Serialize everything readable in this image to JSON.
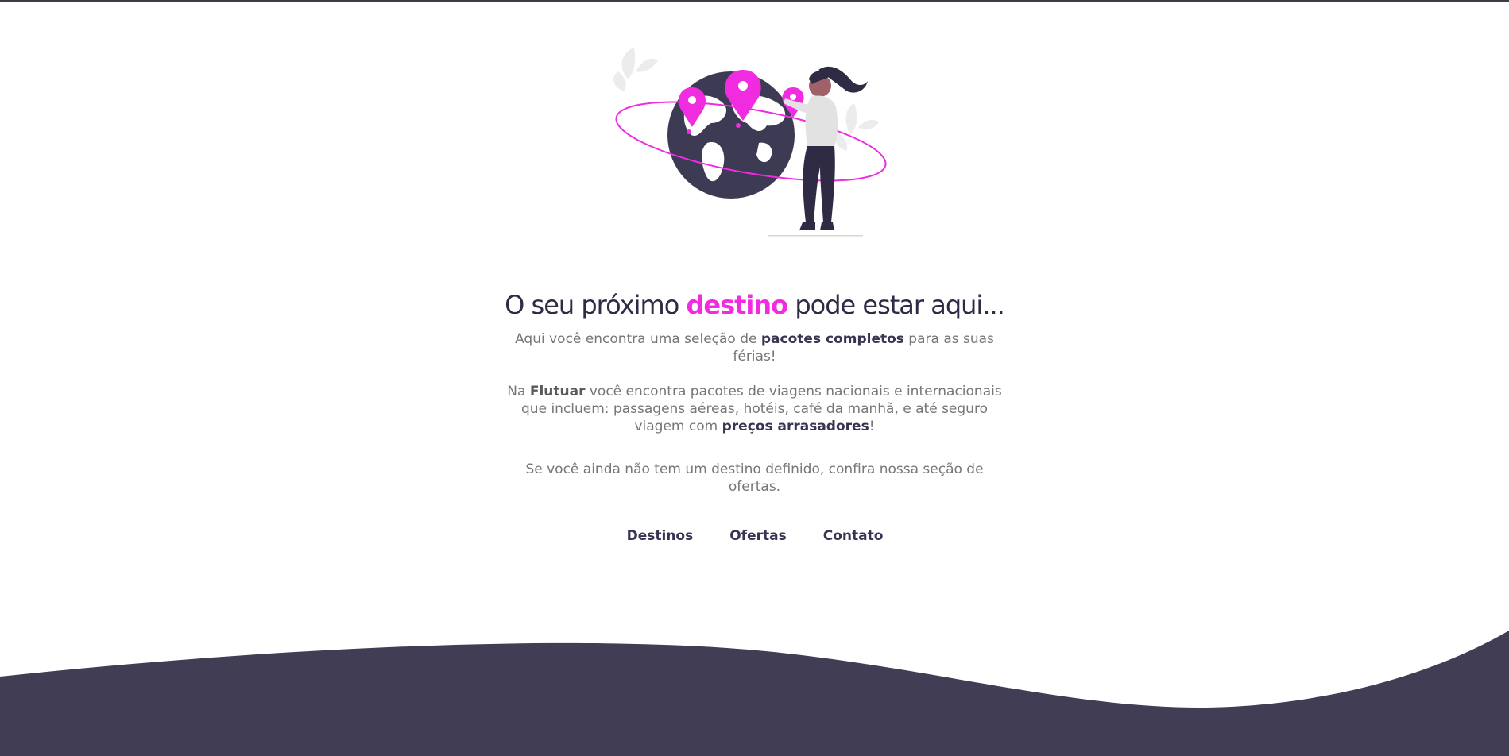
{
  "headline": {
    "before": "O seu próximo ",
    "accent": "destino",
    "after": " pode estar aqui..."
  },
  "intro": {
    "before": "Aqui você encontra uma seleção de ",
    "bold": "pacotes completos",
    "after": " para as suas férias!"
  },
  "details": {
    "before": "Na ",
    "brand": "Flutuar",
    "middle": " você encontra pacotes de viagens nacionais e internacionais que incluem: passagens aéreas, hotéis, café da manhã, e até seguro viagem com ",
    "bold": "preços arrasadores",
    "after": "!"
  },
  "offers_hint": "Se você ainda não tem um destino definido, confira nossa seção de ofertas.",
  "nav": {
    "destinos": "Destinos",
    "ofertas": "Ofertas",
    "contato": "Contato"
  },
  "colors": {
    "accent": "#f02be0",
    "dark": "#3d3a54",
    "text": "#767676"
  },
  "illustration": {
    "icons": [
      "globe-icon",
      "map-pin-icon",
      "traveler-woman-illustration",
      "leaf-icon"
    ]
  }
}
